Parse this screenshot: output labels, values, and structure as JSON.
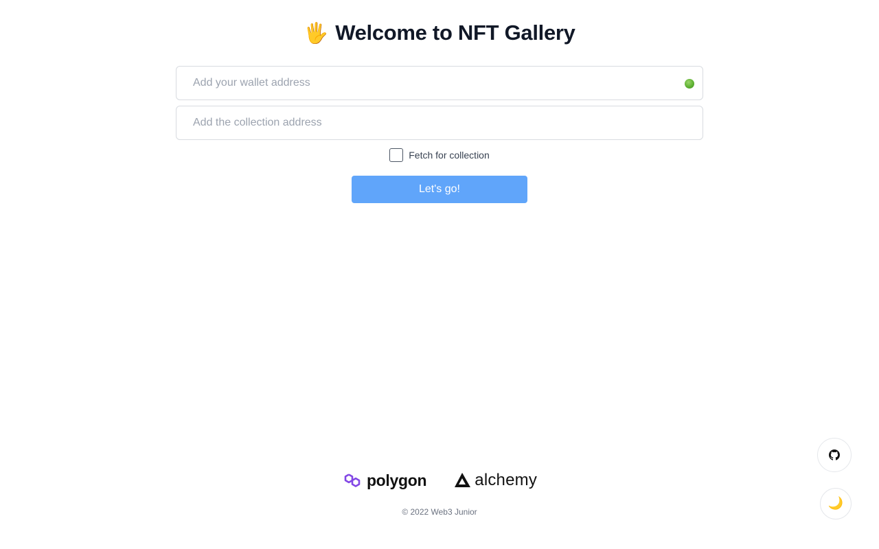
{
  "header": {
    "emoji": "🖐",
    "title": "Welcome to NFT Gallery"
  },
  "form": {
    "wallet_placeholder": "Add your wallet address",
    "wallet_value": "",
    "wallet_status_color": "#5fb233",
    "collection_placeholder": "Add the collection address",
    "collection_value": "",
    "fetch_collection_label": "Fetch for collection",
    "fetch_collection_checked": false,
    "submit_label": "Let's go!",
    "submit_color": "#60a5fa"
  },
  "partners": [
    {
      "name": "polygon",
      "icon": "polygon-logo-icon",
      "color": "#8247e5"
    },
    {
      "name": "alchemy",
      "icon": "alchemy-logo-icon",
      "color": "#111111"
    }
  ],
  "footer": {
    "copyright": "© 2022 Web3 Junior"
  },
  "floating": {
    "github_icon": "github-icon",
    "theme_icon": "moon-icon",
    "theme_glyph": "🌙"
  }
}
